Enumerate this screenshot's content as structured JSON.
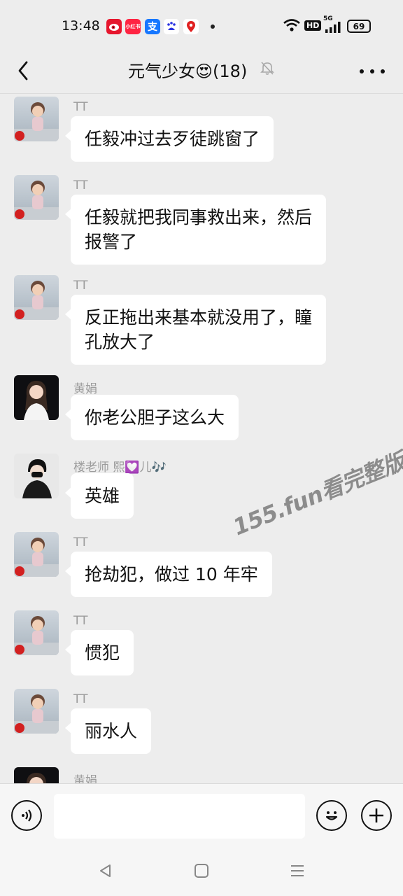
{
  "status_bar": {
    "time": "13:48",
    "apps": [
      {
        "name": "weibo-icon",
        "label": "微",
        "color": "#e6162d"
      },
      {
        "name": "xiaohongshu-icon",
        "label": "小红书",
        "color": "#ff2442"
      },
      {
        "name": "alipay-icon",
        "label": "支",
        "color": "#1677ff"
      },
      {
        "name": "baidu-icon",
        "label": "百",
        "color": "#ffffff"
      },
      {
        "name": "map-pin-icon",
        "label": "",
        "color": "#ffffff"
      }
    ],
    "hd_label": "HD",
    "network_label": "5G",
    "battery": "69"
  },
  "header": {
    "title": "元气少女😍(18)"
  },
  "messages": [
    {
      "sender": "TT",
      "avatar": "boy",
      "lines": [
        "任毅冲过去歹徒跳窗了"
      ]
    },
    {
      "sender": "TT",
      "avatar": "boy",
      "lines": [
        "任毅就把我同事救出来，然后",
        "报警了"
      ]
    },
    {
      "sender": "TT",
      "avatar": "boy",
      "lines": [
        "反正拖出来基本就没用了，瞳",
        "孔放大了"
      ]
    },
    {
      "sender": "黄娟",
      "avatar": "woman",
      "lines": [
        "你老公胆子这么大"
      ]
    },
    {
      "sender": "楼老师 熙💟儿🎶",
      "avatar": "mask",
      "lines": [
        "英雄"
      ]
    },
    {
      "sender": "TT",
      "avatar": "boy",
      "lines": [
        "抢劫犯，做过 10 年牢"
      ]
    },
    {
      "sender": "TT",
      "avatar": "boy",
      "lines": [
        "惯犯"
      ]
    },
    {
      "sender": "TT",
      "avatar": "boy",
      "lines": [
        "丽水人"
      ]
    },
    {
      "sender": "黄娟",
      "avatar": "woman",
      "lines": []
    }
  ],
  "watermark": "155.fun看完整版",
  "input_bar": {
    "placeholder": ""
  }
}
